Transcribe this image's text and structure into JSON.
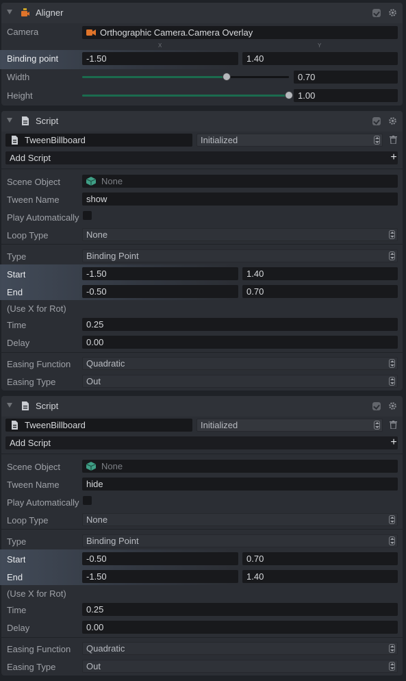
{
  "aligner": {
    "title": "Aligner",
    "camera_label": "Camera",
    "camera_value": "Orthographic Camera.Camera Overlay",
    "axis_x": "X",
    "axis_y": "Y",
    "binding_label": "Binding point",
    "binding_x": "-1.50",
    "binding_y": "1.40",
    "width_label": "Width",
    "width_value": "0.70",
    "width_fraction": 0.7,
    "height_label": "Height",
    "height_value": "1.00",
    "height_fraction": 1.0
  },
  "scripts": [
    {
      "title": "Script",
      "script_name": "TweenBillboard",
      "status": "Initialized",
      "add_script": "Add Script",
      "scene_object_label": "Scene Object",
      "scene_object_value": "None",
      "tween_name_label": "Tween Name",
      "tween_name_value": "show",
      "play_auto_label": "Play Automatically",
      "loop_type_label": "Loop Type",
      "loop_type_value": "None",
      "type_label": "Type",
      "type_value": "Binding Point",
      "start_label": "Start",
      "start_x": "-1.50",
      "start_y": "1.40",
      "end_label": "End",
      "end_x": "-0.50",
      "end_y": "0.70",
      "rot_note": "(Use X for Rot)",
      "time_label": "Time",
      "time_value": "0.25",
      "delay_label": "Delay",
      "delay_value": "0.00",
      "easing_fn_label": "Easing Function",
      "easing_fn_value": "Quadratic",
      "easing_type_label": "Easing Type",
      "easing_type_value": "Out"
    },
    {
      "title": "Script",
      "script_name": "TweenBillboard",
      "status": "Initialized",
      "add_script": "Add Script",
      "scene_object_label": "Scene Object",
      "scene_object_value": "None",
      "tween_name_label": "Tween Name",
      "tween_name_value": "hide",
      "play_auto_label": "Play Automatically",
      "loop_type_label": "Loop Type",
      "loop_type_value": "None",
      "type_label": "Type",
      "type_value": "Binding Point",
      "start_label": "Start",
      "start_x": "-0.50",
      "start_y": "0.70",
      "end_label": "End",
      "end_x": "-1.50",
      "end_y": "1.40",
      "rot_note": "(Use X for Rot)",
      "time_label": "Time",
      "time_value": "0.25",
      "delay_label": "Delay",
      "delay_value": "0.00",
      "easing_fn_label": "Easing Function",
      "easing_fn_value": "Quadratic",
      "easing_type_label": "Easing Type",
      "easing_type_value": "Out"
    }
  ],
  "colors": {
    "background": "#1f2227",
    "panel": "#2b2e34",
    "field": "#18191c",
    "slider_fill": "#1b6b4e",
    "camera_icon": "#e0742a",
    "scene_icon": "#3f9f86"
  }
}
